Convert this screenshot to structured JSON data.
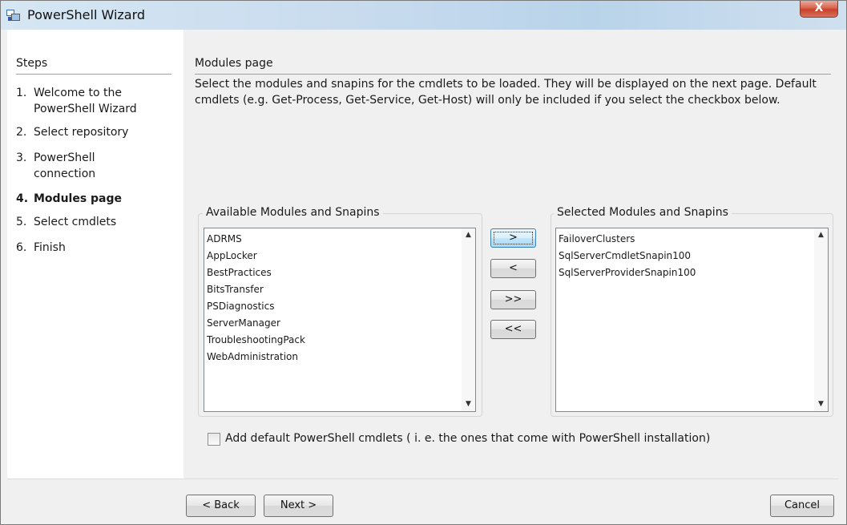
{
  "window": {
    "title": "PowerShell Wizard",
    "close_glyph": "X"
  },
  "steps": {
    "heading": "Steps",
    "items": [
      {
        "num": "1.",
        "label": "Welcome to the PowerShell Wizard"
      },
      {
        "num": "2.",
        "label": "Select repository"
      },
      {
        "num": "3.",
        "label": "PowerShell connection"
      },
      {
        "num": "4.",
        "label": "Modules page"
      },
      {
        "num": "5.",
        "label": "Select cmdlets"
      },
      {
        "num": "6.",
        "label": "Finish"
      }
    ],
    "current_index": 3
  },
  "main": {
    "title": "Modules page",
    "description": "Select the modules and snapins for the cmdlets to be loaded. They will be displayed on the next page. Default cmdlets (e.g. Get-Process, Get-Service, Get-Host) will only be included if you select the checkbox below."
  },
  "available": {
    "label": "Available Modules and Snapins",
    "items": [
      "ADRMS",
      "AppLocker",
      "BestPractices",
      "BitsTransfer",
      "PSDiagnostics",
      "ServerManager",
      "TroubleshootingPack",
      "WebAdministration"
    ]
  },
  "selected": {
    "label": "Selected Modules and Snapins",
    "items": [
      "FailoverClusters",
      "SqlServerCmdletSnapin100",
      "SqlServerProviderSnapin100"
    ]
  },
  "transfer_buttons": {
    "add": ">",
    "remove": "<",
    "add_all": ">>",
    "remove_all": "<<"
  },
  "checkbox": {
    "label": "Add default PowerShell cmdlets ( i. e. the ones that come with PowerShell installation)",
    "checked": false
  },
  "footer": {
    "back": "< Back",
    "next": "Next >",
    "cancel": "Cancel"
  },
  "icons": {
    "app": "powershell-wizard-icon",
    "scroll_up": "▲",
    "scroll_down": "▼"
  }
}
